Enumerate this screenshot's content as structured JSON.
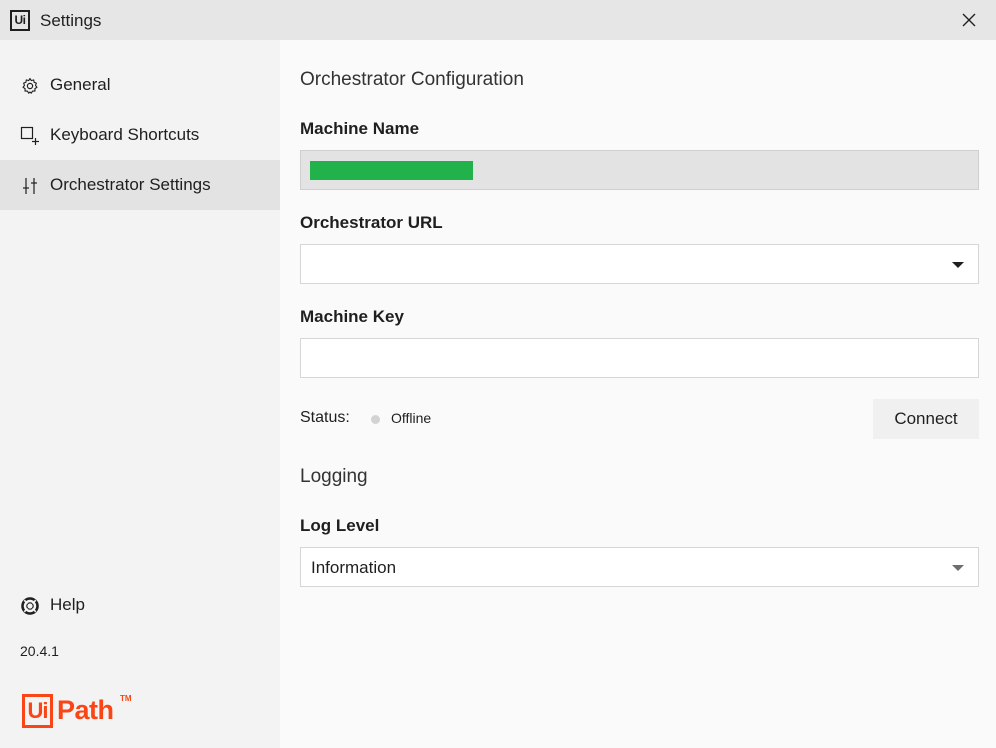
{
  "window": {
    "logo_text": "Ui",
    "title": "Settings",
    "close_icon": "close-icon"
  },
  "sidebar": {
    "items": [
      {
        "label": "General",
        "icon": "gear-icon",
        "active": false
      },
      {
        "label": "Keyboard Shortcuts",
        "icon": "keyboard-shortcut-icon",
        "active": false
      },
      {
        "label": "Orchestrator Settings",
        "icon": "sliders-icon",
        "active": true
      }
    ],
    "help_label": "Help",
    "help_icon": "lifebuoy-icon",
    "version": "20.4.1",
    "brand": {
      "ui": "Ui",
      "path": "Path",
      "tm": "TM",
      "color": "#fa4616"
    }
  },
  "main": {
    "orchestrator_heading": "Orchestrator Configuration",
    "machine_name": {
      "label": "Machine Name",
      "value_redacted": true,
      "redaction_color": "#21b24b"
    },
    "orchestrator_url": {
      "label": "Orchestrator URL",
      "value": ""
    },
    "machine_key": {
      "label": "Machine Key",
      "value": ""
    },
    "status": {
      "label": "Status:",
      "value": "Offline",
      "dot_color": "#d3d3d3"
    },
    "connect_label": "Connect",
    "logging_heading": "Logging",
    "log_level": {
      "label": "Log Level",
      "value": "Information"
    }
  }
}
